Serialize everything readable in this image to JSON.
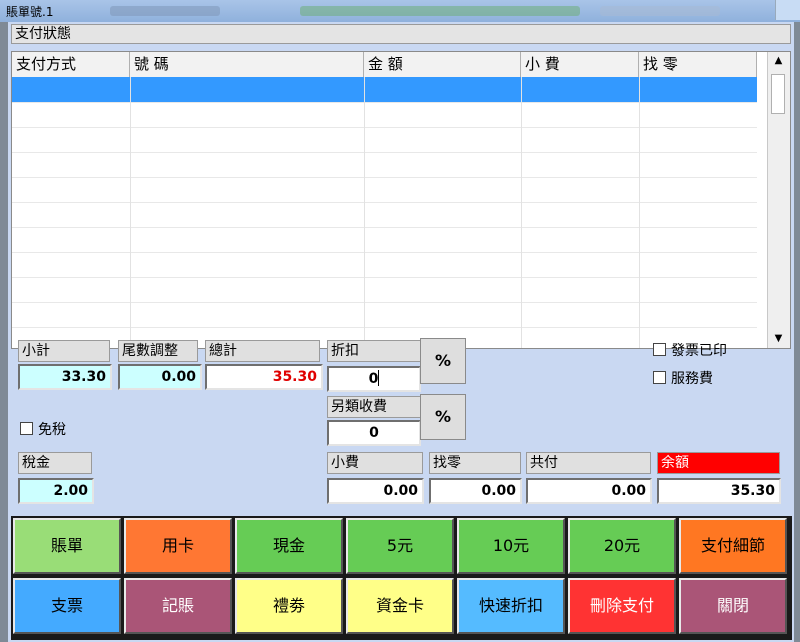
{
  "window": {
    "title": "賬單號.1"
  },
  "section": {
    "title": "支付狀態"
  },
  "table": {
    "columns": [
      "支付方式",
      "號 碼",
      "金 額",
      "小 費",
      "找 零"
    ],
    "rows": []
  },
  "summary": {
    "subtotal": {
      "label": "小計",
      "value": "33.30"
    },
    "rounding": {
      "label": "尾數調整",
      "value": "0.00"
    },
    "total": {
      "label": "總計",
      "value": "35.30"
    },
    "discount": {
      "label": "折扣",
      "value": "0",
      "pct": "%"
    },
    "extra_charge": {
      "label": "另類收費",
      "value": "0",
      "pct": "%"
    },
    "tax_free": {
      "label": "免稅"
    },
    "tax": {
      "label": "稅金",
      "value": "2.00"
    },
    "tip": {
      "label": "小費",
      "value": "0.00"
    },
    "change": {
      "label": "找零",
      "value": "0.00"
    },
    "total_paid": {
      "label": "共付",
      "value": "0.00"
    },
    "balance": {
      "label": "余額",
      "value": "35.30"
    },
    "invoice_printed": {
      "label": "發票已印"
    },
    "service_charge": {
      "label": "服務費"
    }
  },
  "buttons": {
    "row1": [
      {
        "label": "賬單",
        "color": "#99dd77"
      },
      {
        "label": "用卡",
        "color": "#ff7733"
      },
      {
        "label": "現金",
        "color": "#66cc55"
      },
      {
        "label": "5元",
        "color": "#66cc55"
      },
      {
        "label": "10元",
        "color": "#66cc55"
      },
      {
        "label": "20元",
        "color": "#66cc55"
      },
      {
        "label": "支付細節",
        "color": "#ff7722"
      }
    ],
    "row2": [
      {
        "label": "支票",
        "color": "#44aaff"
      },
      {
        "label": "記賬",
        "color": "#aa5577"
      },
      {
        "label": "禮劵",
        "color": "#ffff88"
      },
      {
        "label": "資金卡",
        "color": "#ffff88"
      },
      {
        "label": "快速折扣",
        "color": "#55bbff"
      },
      {
        "label": "刪除支付",
        "color": "#ff3333"
      },
      {
        "label": "關閉",
        "color": "#aa5577"
      }
    ]
  }
}
